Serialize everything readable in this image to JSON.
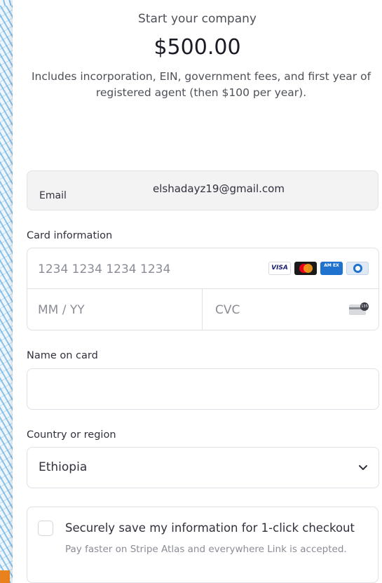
{
  "header": {
    "product_name": "Start your company",
    "price": "$500.00",
    "description": "Includes incorporation, EIN, government fees, and first year of registered agent (then $100 per year)."
  },
  "email": {
    "label": "Email",
    "value": "elshadayz19@gmail.com"
  },
  "card": {
    "label": "Card information",
    "number_placeholder": "1234 1234 1234 1234",
    "expiry_placeholder": "MM / YY",
    "cvc_placeholder": "CVC",
    "brands": [
      "visa-icon",
      "mastercard-icon",
      "amex-icon",
      "diners-icon"
    ],
    "visa_text": "VISA",
    "amex_text": "AM EX",
    "cvc_badge": "135"
  },
  "name_on_card": {
    "label": "Name on card",
    "value": ""
  },
  "country": {
    "label": "Country or region",
    "selected": "Ethiopia"
  },
  "save_info": {
    "title": "Securely save my information for 1-click checkout",
    "subtitle": "Pay faster on Stripe Atlas and everywhere Link is accepted."
  },
  "colors": {
    "text_primary": "#30313d",
    "text_muted": "#8b8d96",
    "border": "#e0e0e6",
    "email_bg": "#f3f3f4"
  }
}
